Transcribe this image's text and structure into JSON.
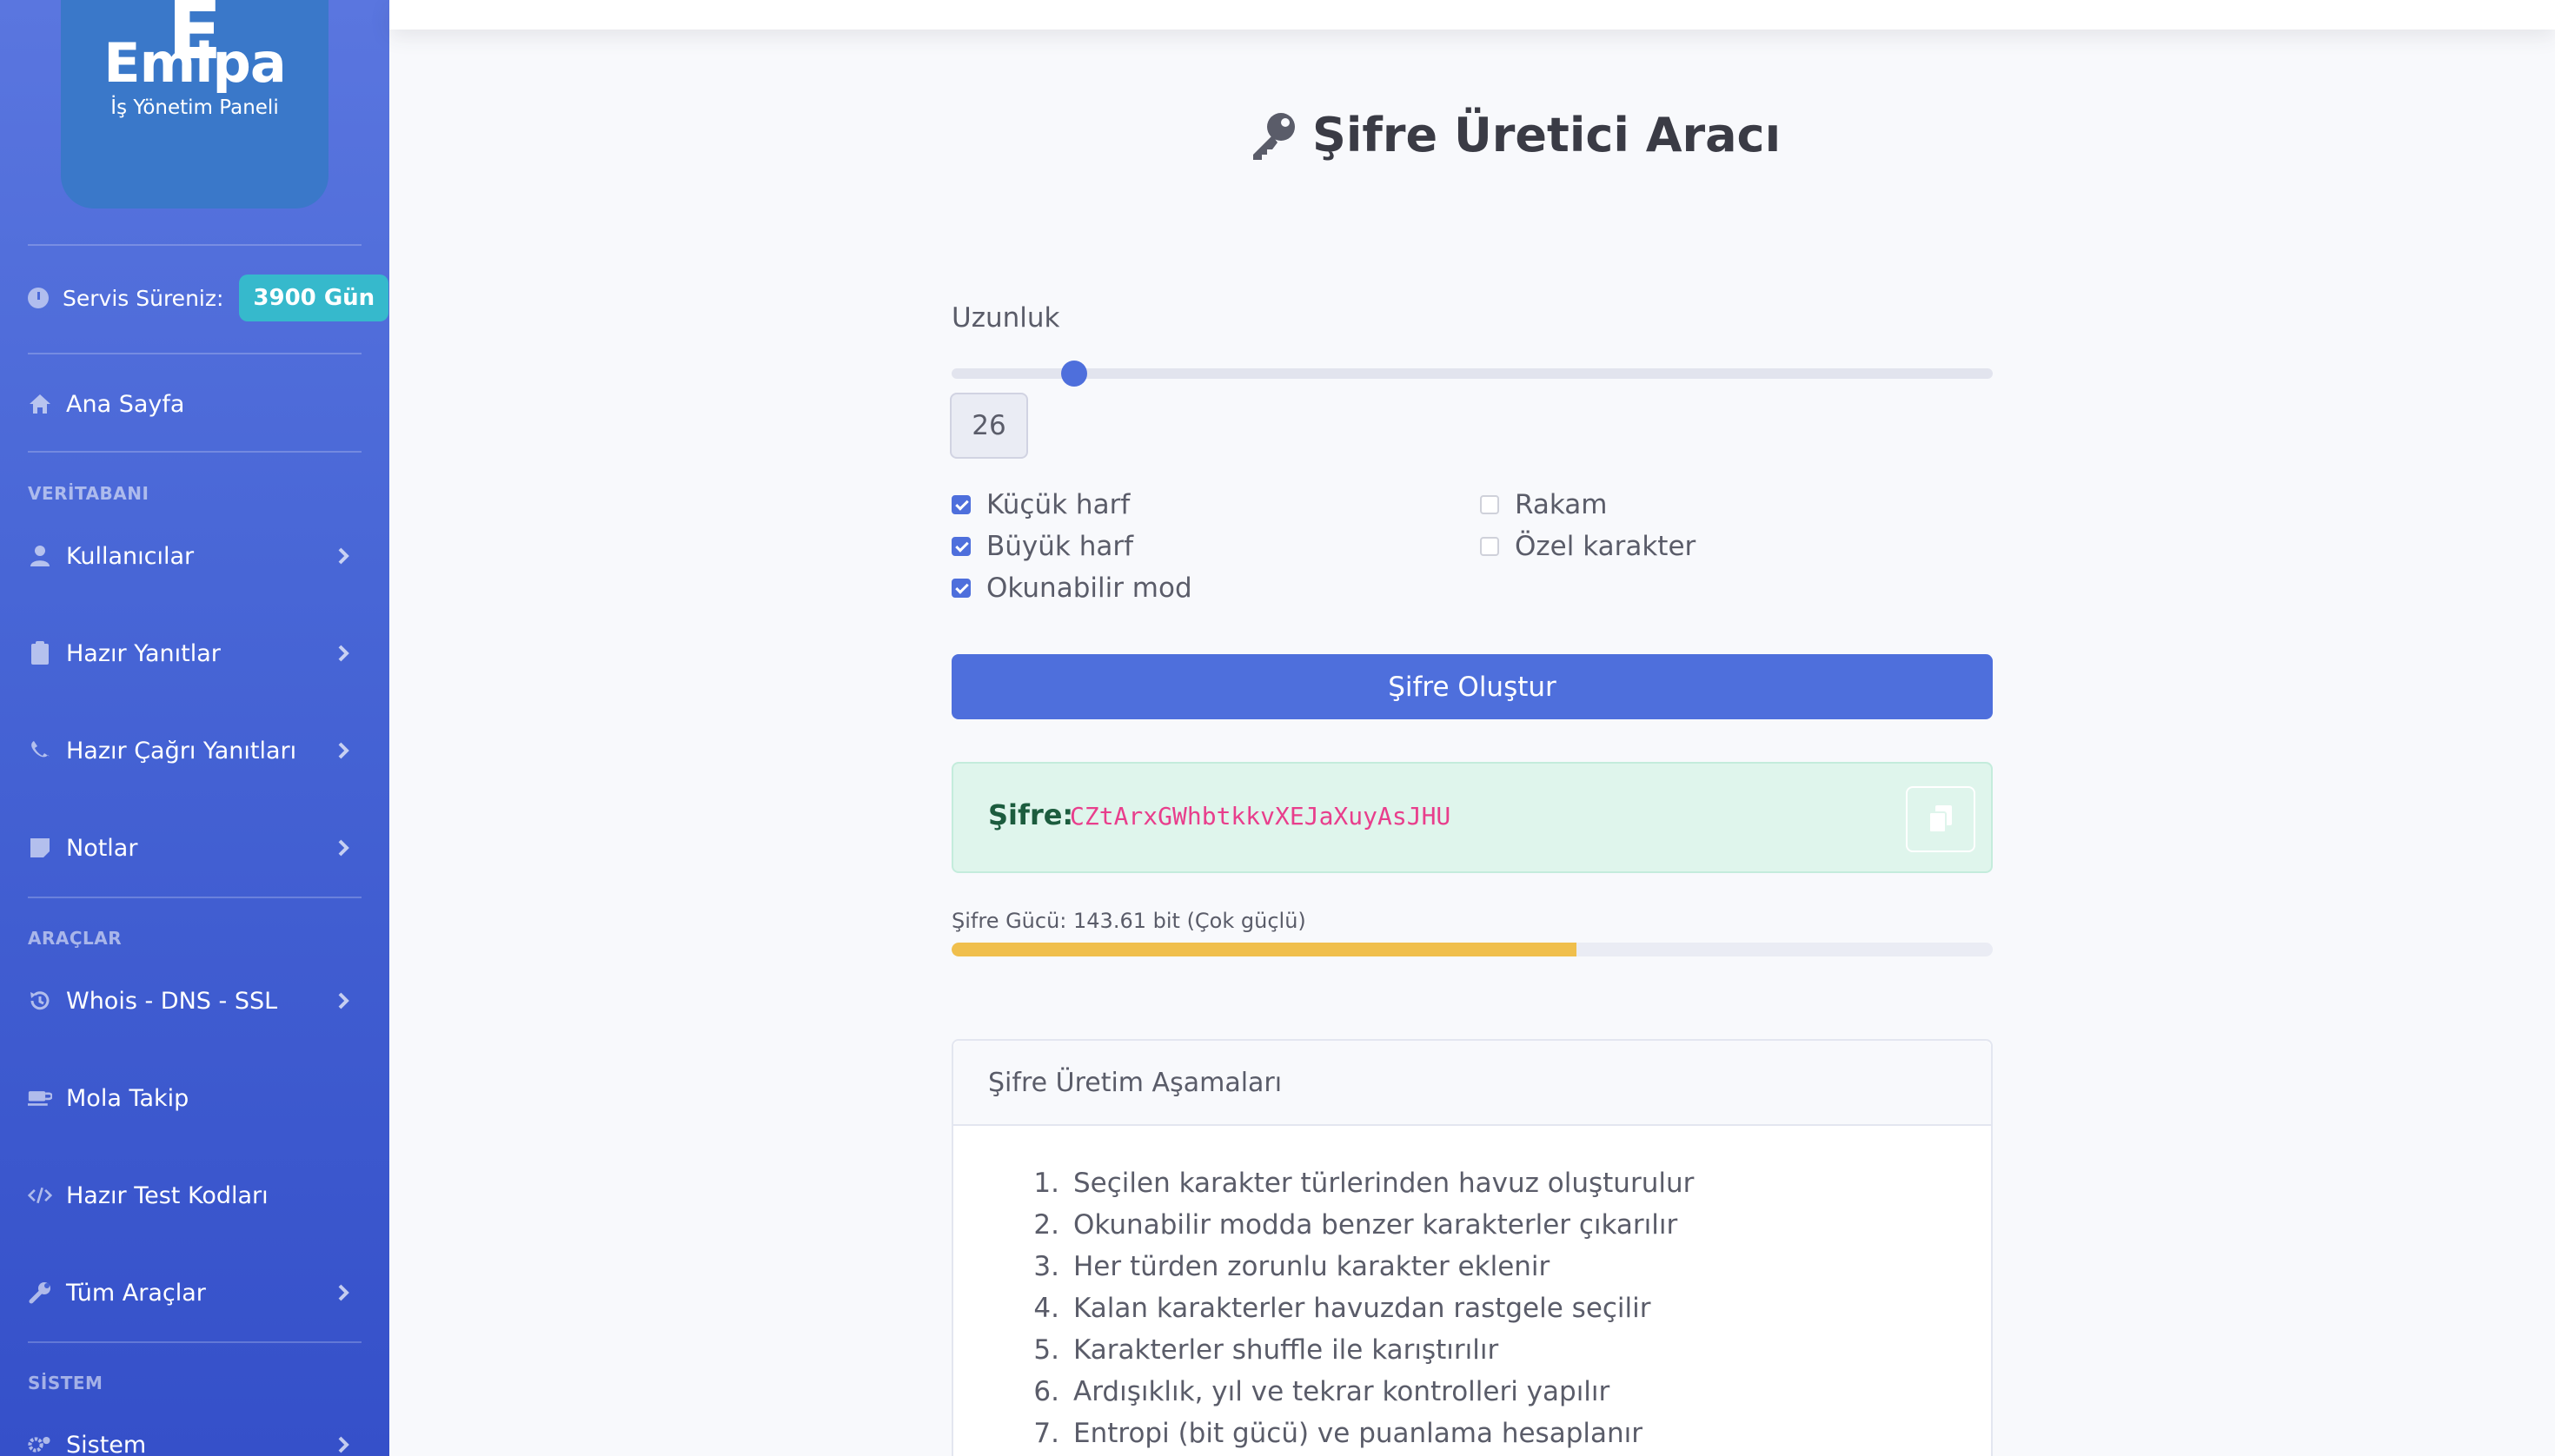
{
  "brand": {
    "letter": "E",
    "name": "Emipa",
    "subtitle": "İş Yönetim Paneli"
  },
  "service": {
    "label": "Servis Süreniz:",
    "badge": "3900 Gün"
  },
  "sidebar": {
    "home": "Ana Sayfa",
    "section_db": "VERİTABANI",
    "users": "Kullanıcılar",
    "ready_replies": "Hazır Yanıtlar",
    "ready_call_replies": "Hazır Çağrı Yanıtları",
    "notes": "Notlar",
    "section_tools": "ARAÇLAR",
    "whois": "Whois - DNS - SSL",
    "break": "Mola Takip",
    "test_codes": "Hazır Test Kodları",
    "all_tools": "Tüm Araçlar",
    "section_system": "SİSTEM",
    "system": "Sistem"
  },
  "page": {
    "title": "Şifre Üretici Aracı"
  },
  "form": {
    "length_label": "Uzunluk",
    "length_value": "26",
    "length_fraction": 0.118,
    "options": {
      "lowercase": "Küçük harf",
      "uppercase": "Büyük harf",
      "readable": "Okunabilir mod",
      "digits": "Rakam",
      "special": "Özel karakter"
    },
    "generate_label": "Şifre Oluştur"
  },
  "result": {
    "label": "Şifre:",
    "value": "CZtArxGWhbtkkvXEJaXuyAsJHU"
  },
  "strength": {
    "label": "Şifre Gücü: 143.61 bit (Çok güçlü)",
    "percent": 60,
    "color": "#f0bf4c"
  },
  "steps": {
    "title": "Şifre Üretim Aşamaları",
    "items": [
      {
        "num": "1.",
        "text": "Seçilen karakter türlerinden havuz oluşturulur"
      },
      {
        "num": "2.",
        "text": "Okunabilir modda benzer karakterler çıkarılır"
      },
      {
        "num": "3.",
        "text": "Her türden zorunlu karakter eklenir"
      },
      {
        "num": "4.",
        "text": "Kalan karakterler havuzdan rastgele seçilir"
      },
      {
        "num": "5.",
        "text": "Karakterler shuffle ile karıştırılır"
      },
      {
        "num": "6.",
        "text": "Ardışıklık, yıl ve tekrar kontrolleri yapılır"
      },
      {
        "num": "7.",
        "text": "Entropi (bit gücü) ve puanlama hesaplanır"
      }
    ]
  }
}
